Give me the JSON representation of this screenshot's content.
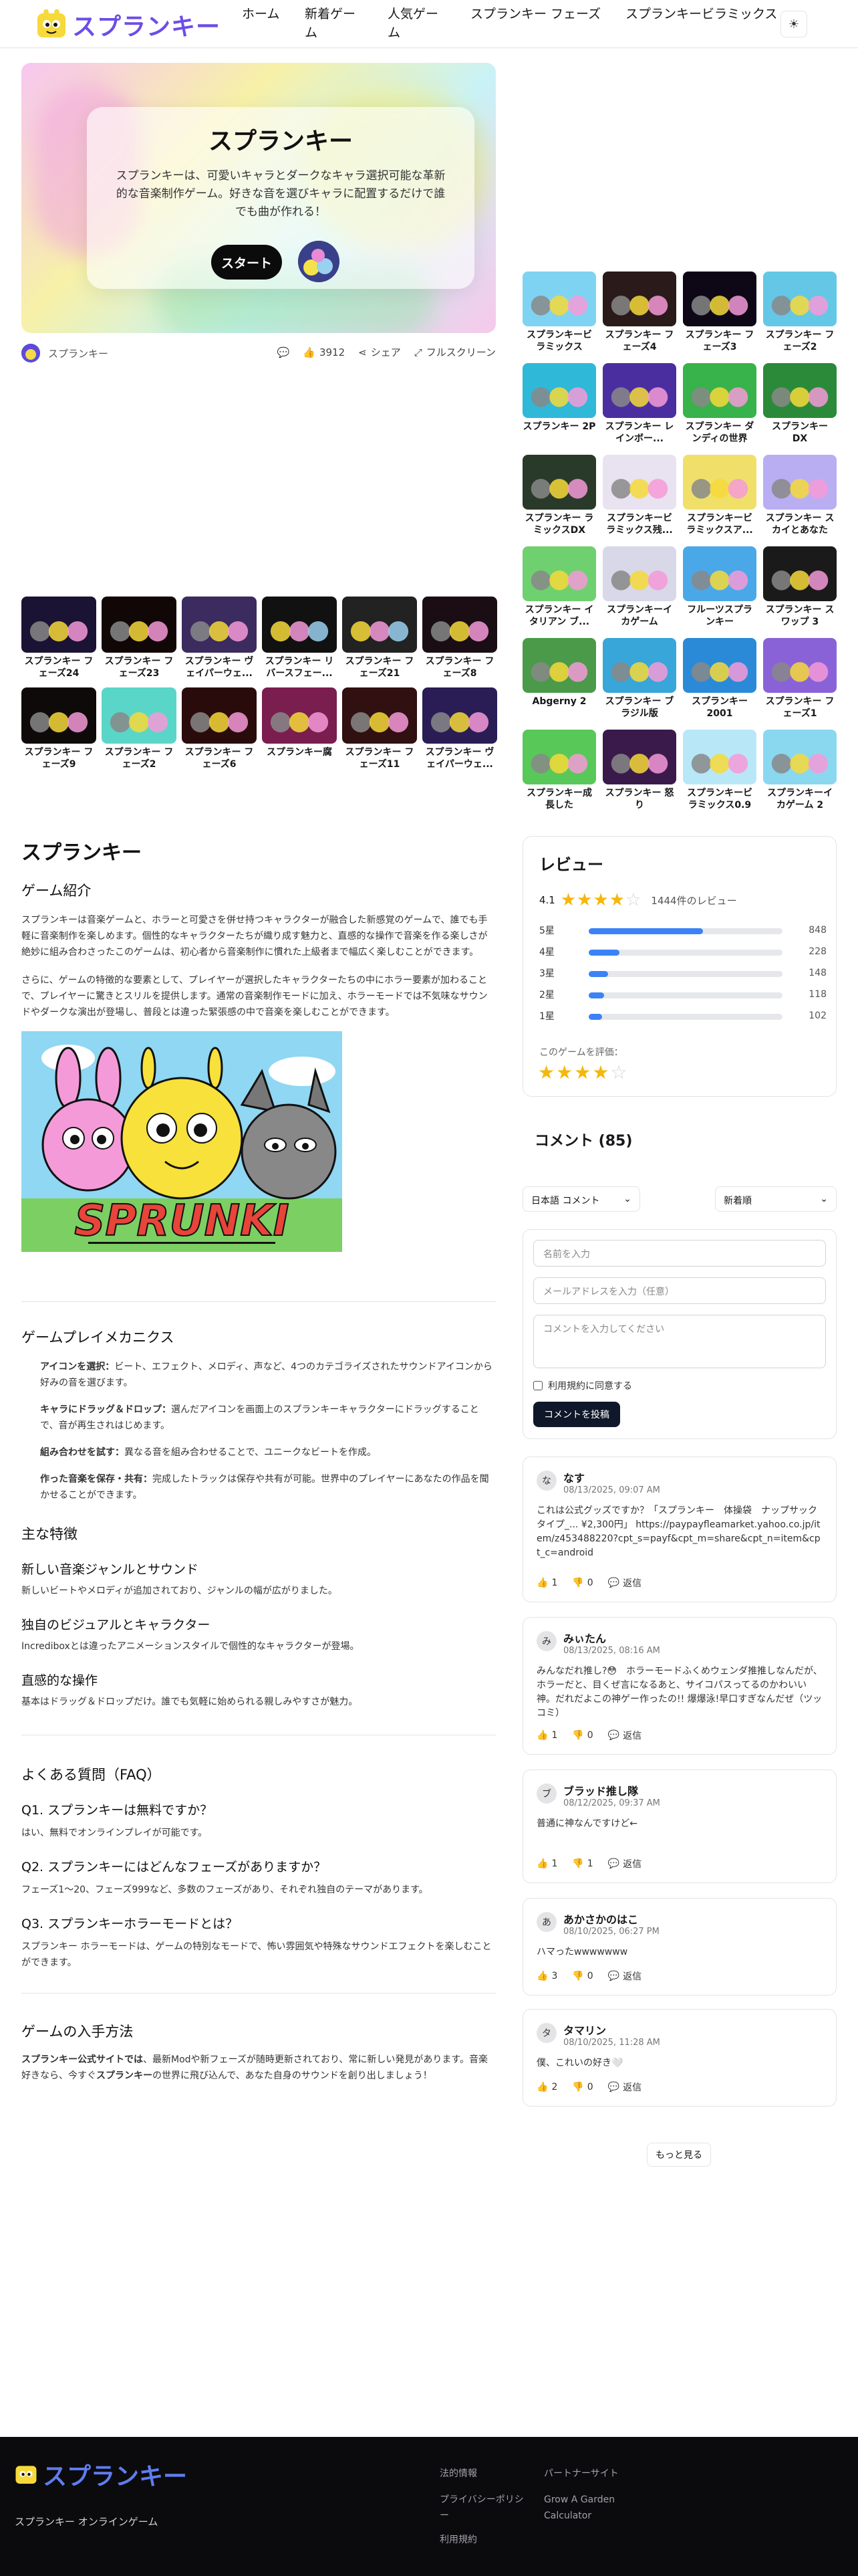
{
  "header": {
    "logo_text": "スプランキー",
    "nav": [
      "ホーム",
      "新着ゲーム",
      "人気ゲーム",
      "スプランキー フェーズ",
      "スプランキービラミックス"
    ],
    "theme_icon": "sun-icon"
  },
  "hero": {
    "title": "スプランキー",
    "description": "スプランキーは、可愛いキャラとダークなキャラ選択可能な革新的な音楽制作ゲーム。好きな音を選びキャラに配置するだけで誰でも曲が作れる！",
    "start_label": "スタート",
    "author": "スプランキー",
    "likes": "3912",
    "share_label": "シェア",
    "fullscreen_label": "フルスクリーン"
  },
  "related_games": [
    {
      "label": "スプランキー フェーズ24",
      "color": "#1b1333"
    },
    {
      "label": "スプランキー フェーズ23",
      "color": "#120707"
    },
    {
      "label": "スプランキー ヴェイパーウェ...",
      "color": "#3b2b5e"
    },
    {
      "label": "スプランキー リバースフェー...",
      "color": "#111"
    },
    {
      "label": "スプランキー フェーズ21",
      "color": "#222"
    },
    {
      "label": "スプランキー フェーズ8",
      "color": "#1a0e14"
    },
    {
      "label": "スプランキー フェーズ9",
      "color": "#0f0a0a"
    },
    {
      "label": "スプランキー フェーズ2",
      "color": "#5ad6c8"
    },
    {
      "label": "スプランキー フェーズ6",
      "color": "#2a0b0b"
    },
    {
      "label": "スプランキー腐",
      "color": "#7a1d4f"
    },
    {
      "label": "スプランキー フェーズ11",
      "color": "#301010"
    },
    {
      "label": "スプランキー ヴェイパーウェ...",
      "color": "#2a1c55"
    }
  ],
  "sidebar_games": [
    {
      "label": "スプランキービ ラミックス",
      "color": "#7fd3f2"
    },
    {
      "label": "スプランキー フェーズ4",
      "color": "#2a1a1a"
    },
    {
      "label": "スプランキー フェーズ3",
      "color": "#0d0716"
    },
    {
      "label": "スプランキー フェーズ2",
      "color": "#64c7e6"
    },
    {
      "label": "スプランキー 2P",
      "color": "#2fb8d8"
    },
    {
      "label": "スプランキー レインボー...",
      "color": "#4a2ea0"
    },
    {
      "label": "スプランキー ダンディの世界",
      "color": "#38b24a"
    },
    {
      "label": "スプランキー DX",
      "color": "#2a8a3a"
    },
    {
      "label": "スプランキー ラミックスDX",
      "color": "#2a3a2a"
    },
    {
      "label": "スプランキービ ラミックス残...",
      "color": "#e9e2f0"
    },
    {
      "label": "スプランキービ ラミックスア...",
      "color": "#f0e06a"
    },
    {
      "label": "スプランキー スカイとあなた",
      "color": "#b9aef2"
    },
    {
      "label": "スプランキー イタリアン ブ...",
      "color": "#6fd070"
    },
    {
      "label": "スプランキーイ カゲーム",
      "color": "#d8d8e8"
    },
    {
      "label": "フルーツスプラ ンキー",
      "color": "#4aa8e8"
    },
    {
      "label": "スプランキー スワップ 3",
      "color": "#1a1a1a"
    },
    {
      "label": "Abgerny 2",
      "color": "#4a9a4a"
    },
    {
      "label": "スプランキー ブラジル版",
      "color": "#38a6d8"
    },
    {
      "label": "スプランキー 2001",
      "color": "#2a8ad8"
    },
    {
      "label": "スプランキー フェーズ1",
      "color": "#8a62d8"
    },
    {
      "label": "スプランキー成 長した",
      "color": "#58c858"
    },
    {
      "label": "スプランキー 怒り",
      "color": "#3a1a4a"
    },
    {
      "label": "スプランキービ ラミックス0.9",
      "color": "#b8e8f8"
    },
    {
      "label": "スプランキーイ カゲーム 2",
      "color": "#8ad8f0"
    }
  ],
  "article": {
    "title": "スプランキー",
    "intro_heading": "ゲーム紹介",
    "intro_p1": "スプランキーは音楽ゲームと、ホラーと可愛さを併せ持つキャラクターが融合した新感覚のゲームで、誰でも手軽に音楽制作を楽しめます。個性的なキャラクターたちが織り成す魅力と、直感的な操作で音楽を作る楽しさが絶妙に組み合わさったこのゲームは、初心者から音楽制作に慣れた上級者まで幅広く楽しむことができます。",
    "intro_p2": "さらに、ゲームの特徴的な要素として、プレイヤーが選択したキャラクターたちの中にホラー要素が加わることで、プレイヤーに驚きとスリルを提供します。通常の音楽制作モードに加え、ホラーモードでは不気味なサウンドやダークな演出が登場し、普段とは違った緊張感の中で音楽を楽しむことができます。",
    "image_title": "SPRUNKI",
    "mechanics_heading": "ゲームプレイメカニクス",
    "mechanics": [
      {
        "bold": "アイコンを選択：",
        "text": "ビート、エフェクト、メロディ、声など、4つのカテゴライズされたサウンドアイコンから好みの音を選びます。"
      },
      {
        "bold": "キャラにドラッグ＆ドロップ：",
        "text": "選んだアイコンを画面上のスプランキーキャラクターにドラッグすることで、音が再生されはじめます。"
      },
      {
        "bold": "組み合わせを試す：",
        "text": "異なる音を組み合わせることで、ユニークなビートを作成。"
      },
      {
        "bold": "作った音楽を保存・共有：",
        "text": "完成したトラックは保存や共有が可能。世界中のプレイヤーにあなたの作品を聞かせることができます。"
      }
    ],
    "features_heading": "主な特徴",
    "features": [
      {
        "title": "新しい音楽ジャンルとサウンド",
        "text": "新しいビートやメロディが追加されており、ジャンルの幅が広がりました。"
      },
      {
        "title": "独自のビジュアルとキャラクター",
        "text": "Incrediboxとは違ったアニメーションスタイルで個性的なキャラクターが登場。"
      },
      {
        "title": "直感的な操作",
        "text": "基本はドラッグ＆ドロップだけ。誰でも気軽に始められる親しみやすさが魅力。"
      }
    ],
    "faq_heading": "よくある質問（FAQ）",
    "faq": [
      {
        "q": "Q1. スプランキーは無料ですか？",
        "a": "はい、無料でオンラインプレイが可能です。"
      },
      {
        "q": "Q2. スプランキーにはどんなフェーズがありますか？",
        "a": "フェーズ1〜20、フェーズ999など、多数のフェーズがあり、それぞれ独自のテーマがあります。"
      },
      {
        "q": "Q3. スプランキーホラーモードとは？",
        "a": "スプランキー ホラーモードは、ゲームの特別なモードで、怖い雰囲気や特殊なサウンドエフェクトを楽しむことができます。"
      }
    ],
    "howto_heading": "ゲームの入手方法",
    "howto_bold1": "スプランキー公式サイトでは",
    "howto_text1": "、最新Modや新フェーズが随時更新されており、常に新しい発見があります。音楽好きなら、今すぐ",
    "howto_bold2": "スプランキー",
    "howto_text2": "の世界に飛び込んで、あなた自身のサウンドを創り出しましょう！"
  },
  "reviews": {
    "title": "レビュー",
    "rating": "4.1",
    "rating_value": 4.1,
    "count_text": "1444件のレビュー",
    "bars": [
      {
        "label": "5星",
        "count": "848",
        "fraction": 0.59
      },
      {
        "label": "4星",
        "count": "228",
        "fraction": 0.16
      },
      {
        "label": "3星",
        "count": "148",
        "fraction": 0.1
      },
      {
        "label": "2星",
        "count": "118",
        "fraction": 0.08
      },
      {
        "label": "1星",
        "count": "102",
        "fraction": 0.07
      }
    ],
    "rate_prompt": "このゲームを評価：",
    "user_rating": 4
  },
  "comments": {
    "title": "コメント (85)",
    "language_select": "日本語 コメント",
    "sort_select": "新着順",
    "name_placeholder": "名前を入力",
    "email_placeholder": "メールアドレスを入力（任意）",
    "comment_placeholder": "コメントを入力してください",
    "terms_label": "利用規約に同意する",
    "submit_label": "コメントを投稿",
    "reply_label": "返信",
    "load_more": "もっと見る",
    "items": [
      {
        "initial": "な",
        "name": "なす",
        "date": "08/13/2025, 09:07 AM",
        "text": "これは公式グッズですか？「スプランキー　体操袋　ナップサックタイプ_... ¥2,300円」 https://paypayfleamarket.yahoo.co.jp/item/z453488220?cpt_s=payf&cpt_m=share&cpt_n=item&cpt_c=android",
        "likes": "1",
        "dislikes": "0"
      },
      {
        "initial": "み",
        "name": "みぃたん",
        "date": "08/13/2025, 08:16 AM",
        "text": "みんなだれ推し?😳　ホラーモードふくめウェンダ推推しなんだが、ホラーだと、目くぜ言になるあと、サイコパスってるのかわいい神。だれだよこの神ゲー作ったの!! 爆爆泳!早口すぎなんだぜ（ツッコミ）",
        "likes": "1",
        "dislikes": "0"
      },
      {
        "initial": "ブ",
        "name": "ブラッド推し隊",
        "date": "08/12/2025, 09:37 AM",
        "text": "普通に神なんですけど←",
        "likes": "1",
        "dislikes": "1"
      },
      {
        "initial": "あ",
        "name": "あかさかのはこ",
        "date": "08/10/2025, 06:27 PM",
        "text": "ハマったwwwwwww",
        "likes": "3",
        "dislikes": "0"
      },
      {
        "initial": "タ",
        "name": "タマリン",
        "date": "08/10/2025, 11:28 AM",
        "text": "僕、これいの好き🤍",
        "likes": "2",
        "dislikes": "0"
      }
    ]
  },
  "footer": {
    "logo_text": "スプランキー",
    "subtitle": "スプランキー オンラインゲーム",
    "legal_title": "法的情報",
    "legal_links": [
      "プライバシーポリシー",
      "利用規約"
    ],
    "partners_title": "パートナーサイト",
    "partner_links": [
      "Grow A Garden Calculator"
    ]
  }
}
